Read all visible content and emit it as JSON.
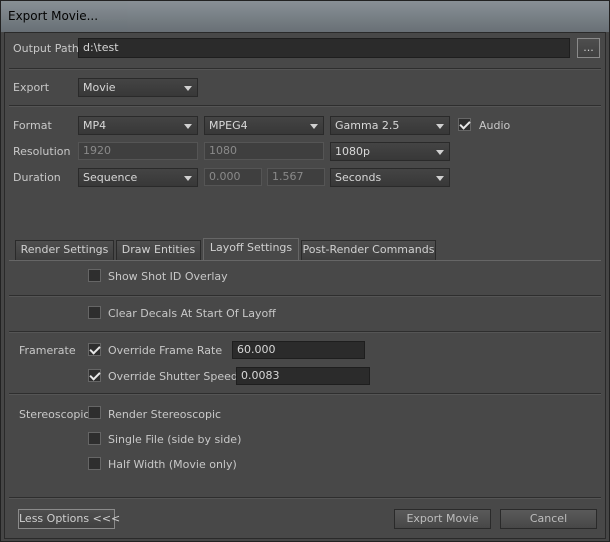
{
  "window": {
    "title": "Export Movie..."
  },
  "output_path": {
    "label": "Output Path",
    "value": "d:\\test",
    "browse_label": "..."
  },
  "export": {
    "label": "Export",
    "value": "Movie"
  },
  "format": {
    "label": "Format",
    "container": "MP4",
    "codec": "MPEG4",
    "gamma": "Gamma 2.5",
    "audio_label": "Audio",
    "audio_checked": true
  },
  "resolution": {
    "label": "Resolution",
    "width": "1920",
    "height": "1080",
    "preset": "1080p"
  },
  "duration": {
    "label": "Duration",
    "mode": "Sequence",
    "start": "0.000",
    "end": "1.567",
    "units": "Seconds"
  },
  "tabs": [
    {
      "label": "Render Settings",
      "active": false
    },
    {
      "label": "Draw Entities",
      "active": false
    },
    {
      "label": "Layoff Settings",
      "active": true
    },
    {
      "label": "Post-Render Commands",
      "active": false
    }
  ],
  "layoff": {
    "show_shot_id": {
      "label": "Show Shot ID Overlay",
      "checked": false
    },
    "clear_decals": {
      "label": "Clear Decals At Start Of Layoff",
      "checked": false
    },
    "framerate": {
      "label": "Framerate",
      "override_rate": {
        "label": "Override Frame Rate",
        "checked": true,
        "value": "60.000"
      },
      "override_shutter": {
        "label": "Override Shutter Speed",
        "checked": true,
        "value": "0.0083"
      }
    },
    "stereoscopic": {
      "label": "Stereoscopic",
      "render": {
        "label": "Render Stereoscopic",
        "checked": false
      },
      "single_file": {
        "label": "Single File (side by side)",
        "checked": false
      },
      "half_width": {
        "label": "Half Width (Movie only)",
        "checked": false
      }
    }
  },
  "footer": {
    "less_options": "Less Options <<<",
    "export_button": "Export Movie",
    "cancel_button": "Cancel"
  }
}
